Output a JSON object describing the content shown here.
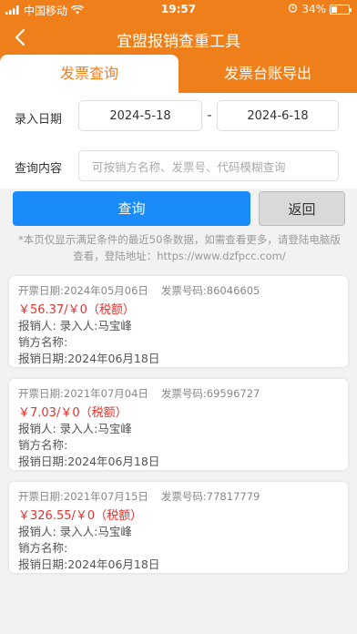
{
  "statusbar": {
    "carrier": "中国移动",
    "time": "19:57",
    "battery_text": "34%",
    "battery_level": 0.34
  },
  "navbar": {
    "title": "宜盟报销查重工具"
  },
  "tabs": [
    {
      "label": "发票查询",
      "active": true
    },
    {
      "label": "发票台账导出",
      "active": false
    }
  ],
  "form": {
    "date_label": "录入日期",
    "date_start": "2024-5-18",
    "date_separator": "-",
    "date_end": "2024-6-18",
    "query_label": "查询内容",
    "query_placeholder": "可按销方名称、发票号、代码模糊查询"
  },
  "buttons": {
    "query": "查询",
    "back": "返回"
  },
  "notice": {
    "line1": "*本页仅显示满足条件的最近50条数据，如需查看更多，请登陆电脑版",
    "line2": "查看，登陆地址：https://www.dzfpcc.com/"
  },
  "records": [
    {
      "invoice_date_label": "开票日期:",
      "invoice_date": "2024年05月06日",
      "invoice_no_label": "发票号码:",
      "invoice_no": "86046605",
      "amount": "￥56.37/￥0（税额）",
      "claimant": "报销人:   录入人:马宝峰",
      "seller": "销方名称:",
      "claim_date": "报销日期:2024年06月18日"
    },
    {
      "invoice_date_label": "开票日期:",
      "invoice_date": "2021年07月04日",
      "invoice_no_label": "发票号码:",
      "invoice_no": "69596727",
      "amount": "￥7.03/￥0（税额）",
      "claimant": "报销人:   录入人:马宝峰",
      "seller": "销方名称:",
      "claim_date": "报销日期:2024年06月18日"
    },
    {
      "invoice_date_label": "开票日期:",
      "invoice_date": "2021年07月15日",
      "invoice_no_label": "发票号码:",
      "invoice_no": "77817779",
      "amount": "￥326.55/￥0（税额）",
      "claimant": "报销人:   录入人:马宝峰",
      "seller": "销方名称:",
      "claim_date": "报销日期:2024年06月18日"
    }
  ],
  "colors": {
    "brand": "#ef7f1a",
    "primary_button": "#1a8bf8",
    "amount": "#e8302a"
  }
}
